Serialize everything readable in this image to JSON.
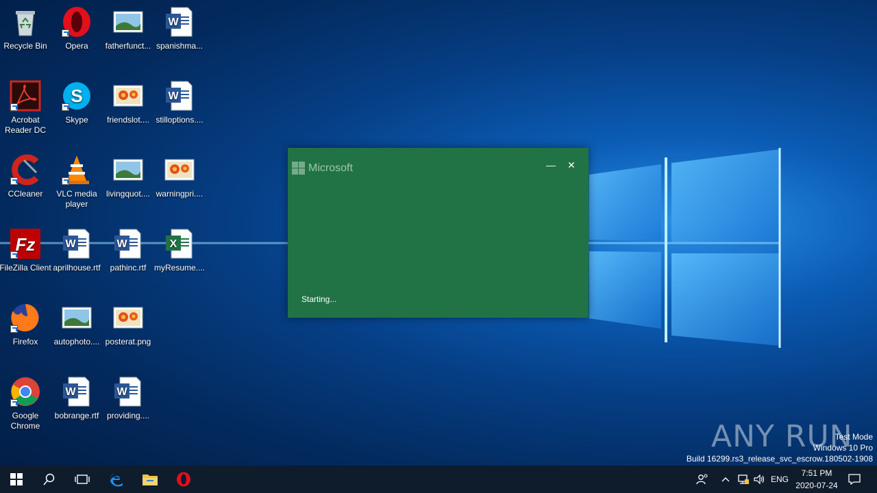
{
  "desktop": {
    "icons": [
      {
        "label": "Recycle Bin",
        "icon": "recycle-bin-icon"
      },
      {
        "label": "Opera",
        "icon": "opera-icon"
      },
      {
        "label": "fatherfunct...",
        "icon": "image-file-icon"
      },
      {
        "label": "spanishma...",
        "icon": "word-document-icon"
      },
      {
        "label": "Acrobat Reader DC",
        "icon": "acrobat-reader-icon"
      },
      {
        "label": "Skype",
        "icon": "skype-icon"
      },
      {
        "label": "friendslot....",
        "icon": "image-flower-icon"
      },
      {
        "label": "stilloptions....",
        "icon": "word-document-icon"
      },
      {
        "label": "CCleaner",
        "icon": "ccleaner-icon"
      },
      {
        "label": "VLC media player",
        "icon": "vlc-icon"
      },
      {
        "label": "livingquot....",
        "icon": "image-file-icon"
      },
      {
        "label": "warningpri....",
        "icon": "image-flower-icon"
      },
      {
        "label": "FileZilla Client",
        "icon": "filezilla-icon"
      },
      {
        "label": "aprilhouse.rtf",
        "icon": "word-document-icon"
      },
      {
        "label": "pathinc.rtf",
        "icon": "word-document-icon"
      },
      {
        "label": "myResume....",
        "icon": "excel-document-icon"
      },
      {
        "label": "Firefox",
        "icon": "firefox-icon"
      },
      {
        "label": "autophoto....",
        "icon": "image-file-icon"
      },
      {
        "label": "posterat.png",
        "icon": "image-flower-icon"
      },
      {
        "label": "Google Chrome",
        "icon": "chrome-icon"
      },
      {
        "label": "bobrange.rtf",
        "icon": "word-document-icon"
      },
      {
        "label": "providing....",
        "icon": "word-document-icon"
      }
    ]
  },
  "splash": {
    "brand": "Microsoft",
    "status": "Starting...",
    "minimize_glyph": "—",
    "close_glyph": "✕",
    "accent": "#217346"
  },
  "watermark": {
    "text": "ANY RUN",
    "line1": "Test Mode",
    "line2": "Windows 10 Pro",
    "line3": "Build 16299.rs3_release_svc_escrow.180502-1908"
  },
  "taskbar": {
    "language": "ENG",
    "time": "7:51 PM",
    "date": "2020-07-24"
  }
}
